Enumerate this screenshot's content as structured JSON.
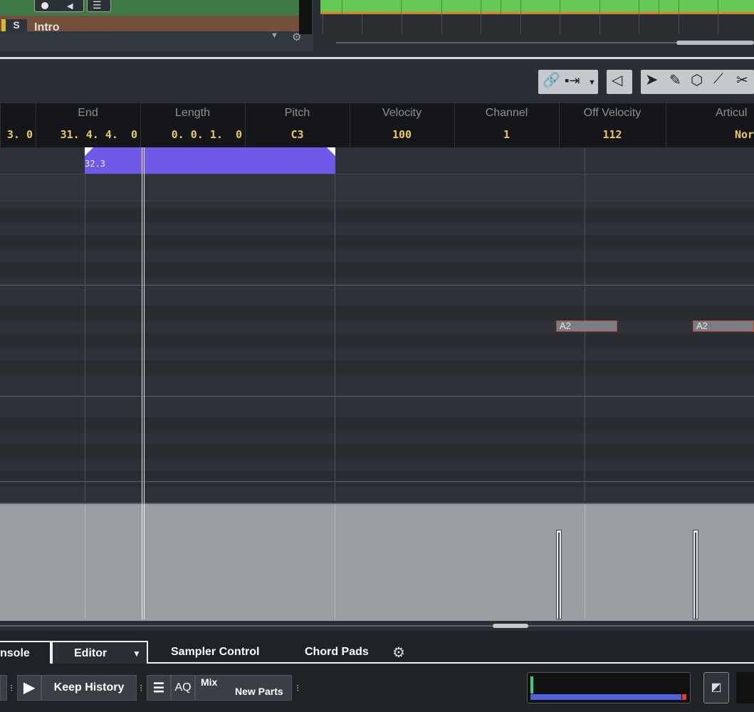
{
  "track": {
    "solo_label": "S",
    "name": "Intro"
  },
  "infoline": {
    "columns": [
      {
        "header": "",
        "value": "3.  0"
      },
      {
        "header": "End",
        "value": "31. 4. 4.  0"
      },
      {
        "header": "Length",
        "value": "0. 0. 1.  0"
      },
      {
        "header": "Pitch",
        "value": "C3"
      },
      {
        "header": "Velocity",
        "value": "100"
      },
      {
        "header": "Channel",
        "value": "1"
      },
      {
        "header": "Off Velocity",
        "value": "112"
      },
      {
        "header": "Articul",
        "value": "Nor"
      }
    ]
  },
  "notes": {
    "selected_label": "32.3",
    "a2_label": "A2"
  },
  "tabs": {
    "console": "nsole",
    "editor": "Editor",
    "sampler": "Sampler Control",
    "chord": "Chord Pads"
  },
  "bottom": {
    "keep_history": "Keep History",
    "aq": "AQ",
    "mix": "Mix",
    "new_parts": "New Parts"
  },
  "colors": {
    "note_selected": "#6e5ae6",
    "green_part": "#63c854",
    "info_value": "#e9c86a"
  }
}
